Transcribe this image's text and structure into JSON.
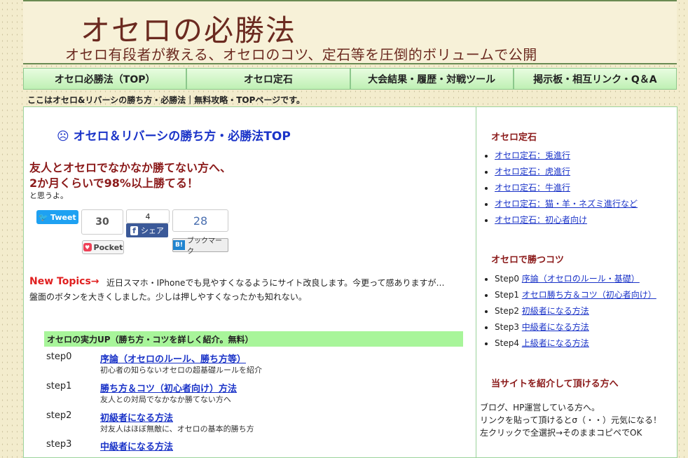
{
  "header": {
    "title": "オセロの必勝法",
    "subtitle": "オセロ有段者が教える、オセロのコツ、定石等を圧倒的ボリュームで公開"
  },
  "nav": [
    {
      "label": "オセロ必勝法（TOP）"
    },
    {
      "label": "オセロ定石"
    },
    {
      "label": "大会結果・履歴・対戦ツール"
    },
    {
      "label": "掲示板・相互リンク・Q＆A"
    }
  ],
  "breadcrumb": "ここはオセロ&リバーシの勝ち方・必勝法｜無料攻略・TOPページです。",
  "main": {
    "page_title": "☹ オセロ＆リバーシの勝ち方・必勝法TOP",
    "lead_line1": "友人とオセロでなかなか勝てない方へ、",
    "lead_line2": "2か月くらいで98%以上勝てる！",
    "lead_line3": "と思うよ。",
    "social": {
      "tweet_label": "Tweet",
      "tweet_count": "30",
      "facebook_count": "4",
      "facebook_label": "シェア",
      "hatena_count": "28",
      "hatena_badge": "B!",
      "hatena_label": "ブックマーク",
      "pocket_label": "Pocket"
    },
    "new_topics_label": "New Topics→",
    "new_topics_text": "近日スマホ・IPhoneでも見やすくなるようにサイト改良します。今更って感ありますが…",
    "new_topics_text2": "盤面のボタンを大きくしました。少しは押しやすくなったかも知れない。",
    "section_heading": "オセロの実力UP（勝ち方・コツを詳しく紹介。無料）",
    "steps": [
      {
        "num": "step0",
        "link": "序論（オセロのルール、勝ち方等）",
        "desc": "初心者の知らないオセロの超基礎ルールを紹介"
      },
      {
        "num": "step1",
        "link": "勝ち方＆コツ（初心者向け）方法",
        "desc": "友人との対局でなかなか勝てない方へ"
      },
      {
        "num": "step2",
        "link": "初級者になる方法",
        "desc": "対友人はほぼ無敵に、オセロの基本的勝ち方"
      },
      {
        "num": "step3",
        "link": "中級者になる方法",
        "desc": ""
      }
    ]
  },
  "sidebar": {
    "joseki_heading": "オセロ定石",
    "joseki_items": [
      {
        "label": "オセロ定石：兎進行"
      },
      {
        "label": "オセロ定石：虎進行"
      },
      {
        "label": "オセロ定石：牛進行"
      },
      {
        "label": "オセロ定石：猫・羊・ネズミ進行など"
      },
      {
        "label": "オセロ定石：初心者向け"
      }
    ],
    "tips_heading": "オセロで勝つコツ",
    "tips_items": [
      {
        "step": "Step0",
        "label": "序論（オセロのルール・基礎）"
      },
      {
        "step": "Step1",
        "label": "オセロ勝ち方＆コツ（初心者向け）"
      },
      {
        "step": "Step2",
        "label": "初級者になる方法"
      },
      {
        "step": "Step3",
        "label": "中級者になる方法"
      },
      {
        "step": "Step4",
        "label": "上級者になる方法"
      }
    ],
    "intro_heading": "当サイトを紹介して頂ける方へ",
    "intro_line1": "ブログ、HP運営している方へ。",
    "intro_line2": "リンクを貼って頂けるとσ（・・）元気になる！",
    "intro_line3": "左クリックで全選択→そのままコピペでOK"
  }
}
